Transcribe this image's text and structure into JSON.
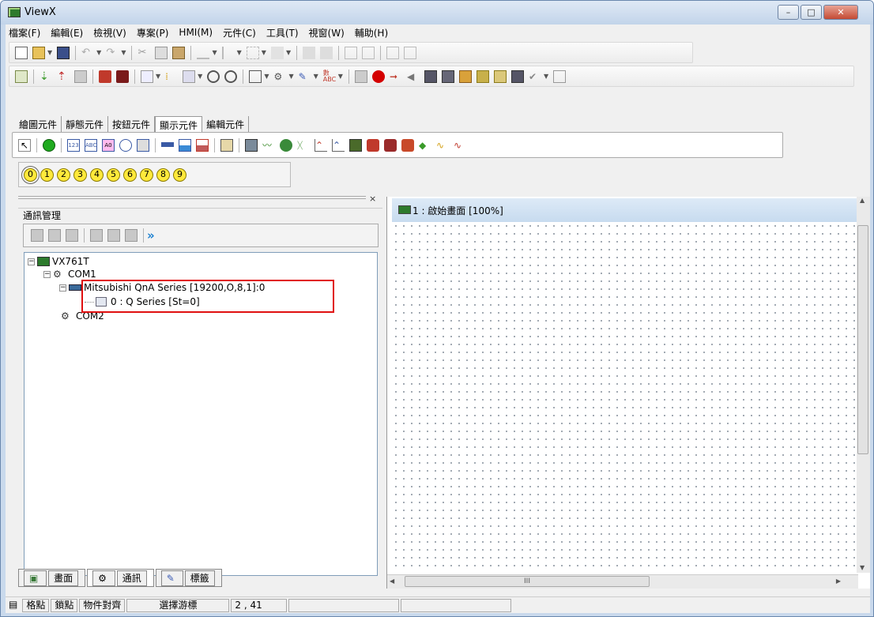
{
  "window": {
    "title": "ViewX",
    "minimize": "–",
    "maximize": "□",
    "close": "✕"
  },
  "menu": [
    "檔案(F)",
    "編輯(E)",
    "檢視(V)",
    "專案(P)",
    "HMI(M)",
    "元件(C)",
    "工具(T)",
    "視窗(W)",
    "輔助(H)"
  ],
  "element_tabs": [
    "繪圖元件",
    "靜態元件",
    "按鈕元件",
    "顯示元件",
    "編輯元件"
  ],
  "active_element_tab": "顯示元件",
  "numbers": [
    "0",
    "1",
    "2",
    "3",
    "4",
    "5",
    "6",
    "7",
    "8",
    "9"
  ],
  "left_panel": {
    "title": "通訊管理",
    "more_label": "»"
  },
  "tree": {
    "root": "VX761T",
    "com1": "COM1",
    "device": "Mitsubishi QnA Series [19200,O,8,1]:0",
    "station": "0 : Q Series [St=0]",
    "com2": "COM2"
  },
  "bottom_tabs": [
    "畫面",
    "通訊",
    "標籤"
  ],
  "canvas": {
    "title": "1 : 啟始畫面 [100%]",
    "scroll_marker": "III"
  },
  "status": {
    "items": [
      "格點",
      "鎖點",
      "物件對齊",
      "選擇游標"
    ],
    "position": "2 , 41"
  }
}
